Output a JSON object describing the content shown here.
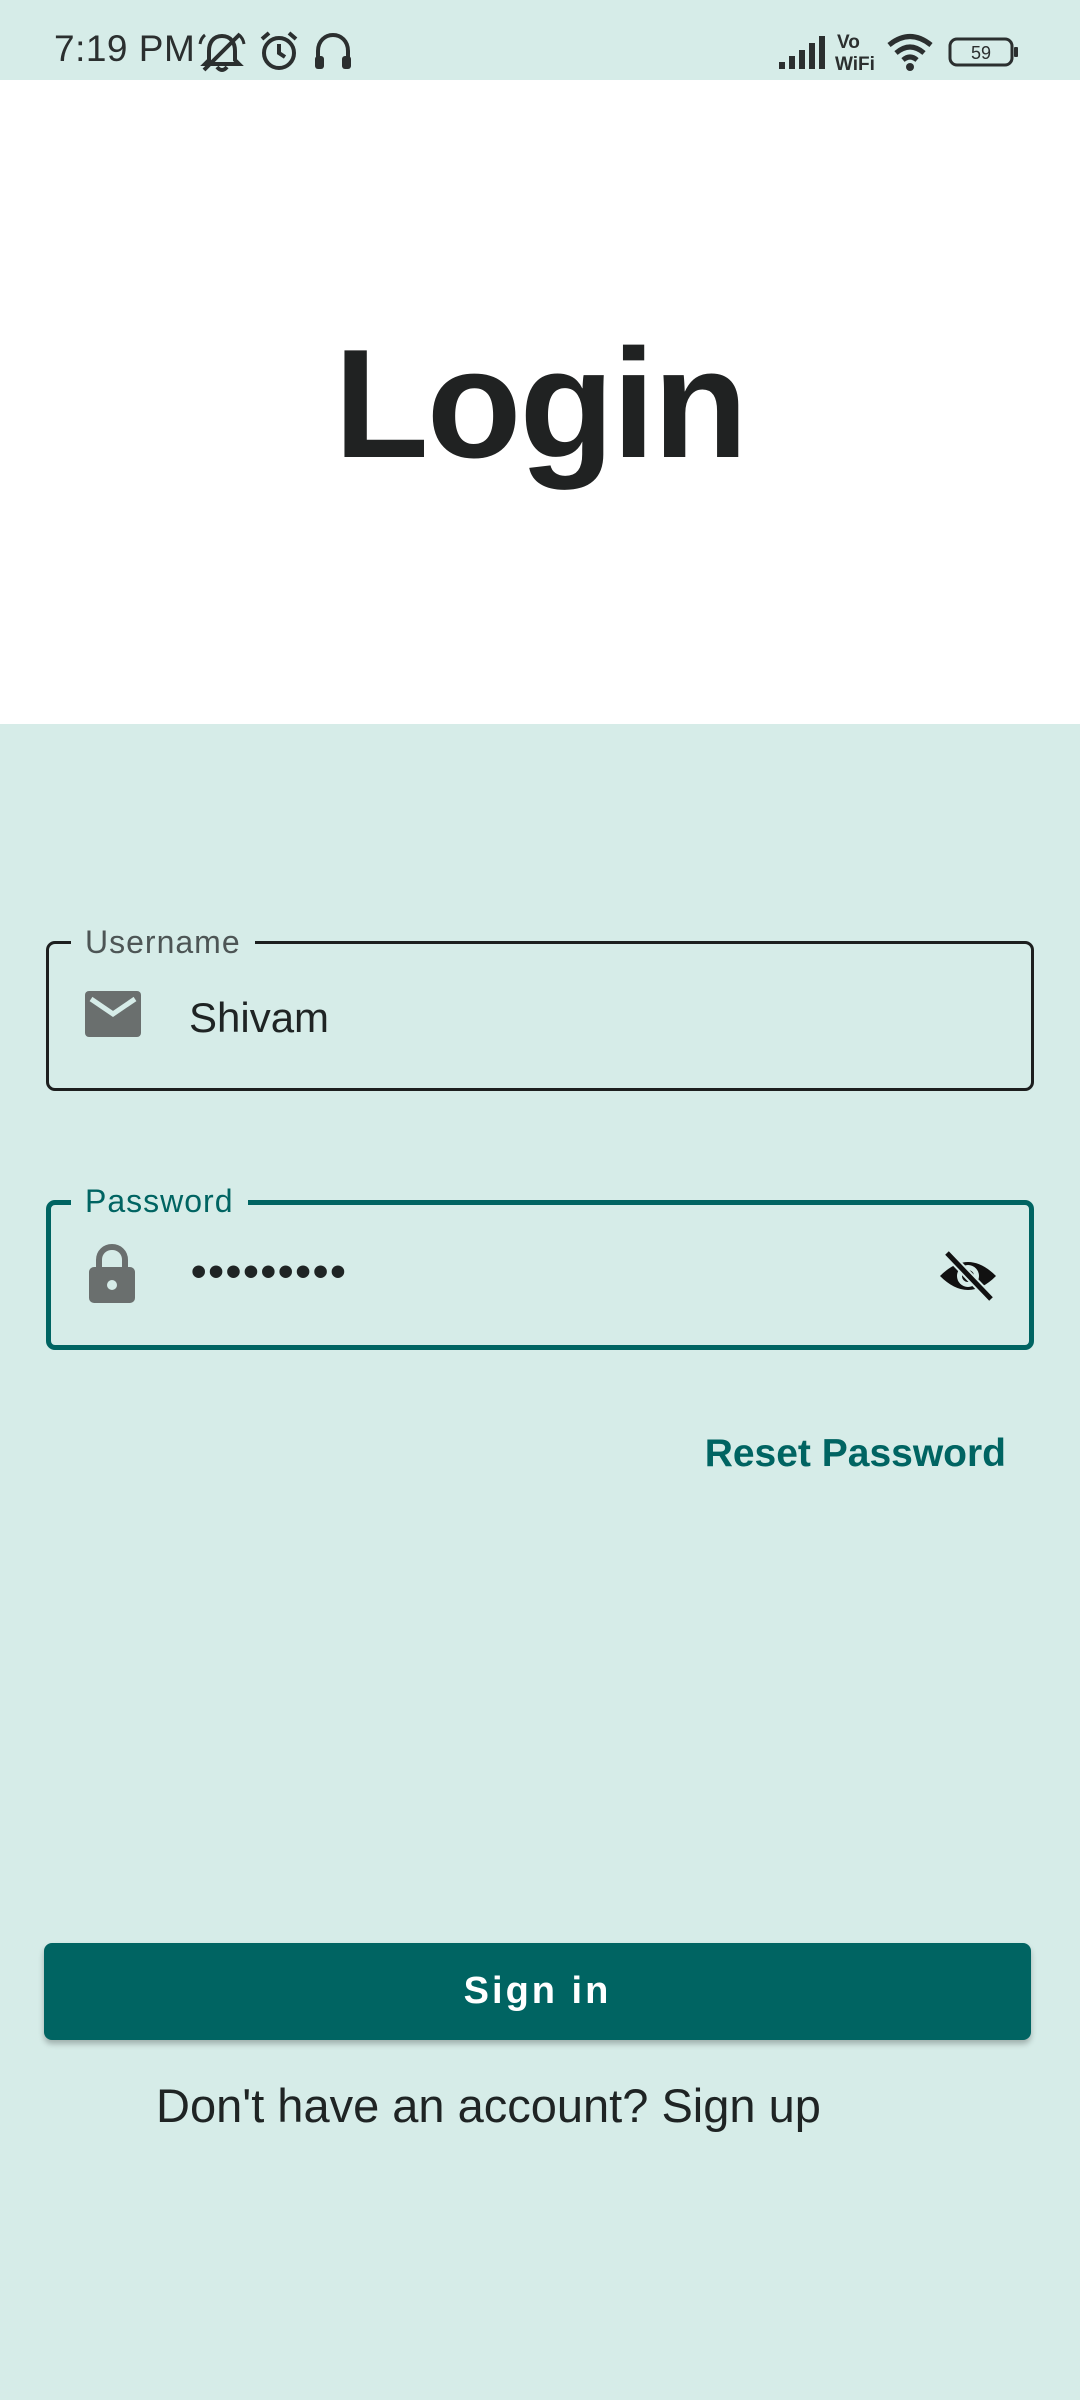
{
  "status_bar": {
    "time": "7:19 PM",
    "icons": [
      "bell-off-icon",
      "alarm-icon",
      "headphones-icon",
      "signal-icon",
      "vowifi-icon",
      "wifi-icon",
      "battery-icon"
    ],
    "vowifi_top": "Vo",
    "vowifi_bottom": "WiFi",
    "battery_level": "59"
  },
  "header": {
    "title": "Login"
  },
  "form": {
    "username": {
      "label": "Username",
      "value": "Shivam",
      "icon": "mail-icon"
    },
    "password": {
      "label": "Password",
      "value": "•••••••••",
      "icon": "lock-icon",
      "toggle_icon": "eye-off-icon"
    },
    "reset_password": "Reset Password",
    "sign_in": "Sign in"
  },
  "footer": {
    "prompt": "Don't have an account?",
    "signup": "Sign up"
  },
  "colors": {
    "background": "#d6ece8",
    "header_background": "#ffffff",
    "accent": "#006462",
    "text": "#1f2424"
  }
}
